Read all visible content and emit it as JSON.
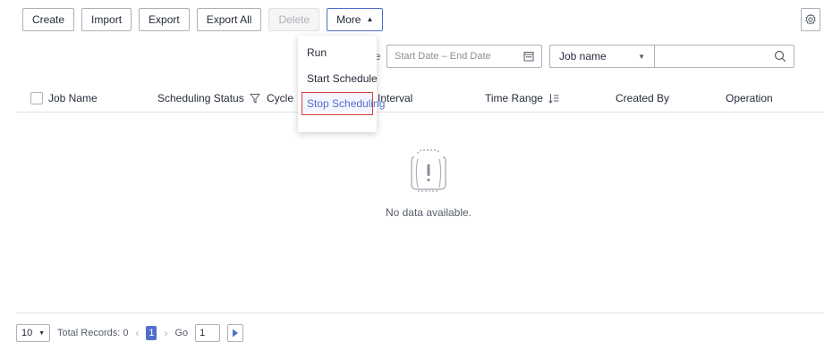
{
  "toolbar": {
    "create": "Create",
    "import": "Import",
    "export": "Export",
    "export_all": "Export All",
    "delete": "Delete",
    "more": "More",
    "settings_icon": "gear-icon"
  },
  "more_menu": {
    "items": [
      "Run",
      "Start Schedule",
      "Stop Scheduling"
    ],
    "selected": "Stop Scheduling"
  },
  "filters": {
    "range_label_fragment": "ge",
    "date_placeholder": "Start Date – End Date",
    "field_select": "Job name",
    "search_value": ""
  },
  "table": {
    "columns": [
      "Job Name",
      "Scheduling Status",
      "Cycle",
      "Interval",
      "Time Range",
      "Created By",
      "Operation"
    ],
    "empty_text": "No data available."
  },
  "pagination": {
    "page_size": "10",
    "total_records": "Total Records: 0",
    "current_page": "1",
    "go_label": "Go",
    "go_value": "1"
  },
  "colors": {
    "accent": "#526ecc",
    "border": "#adb0b8",
    "highlight_border": "#e23a3a"
  }
}
